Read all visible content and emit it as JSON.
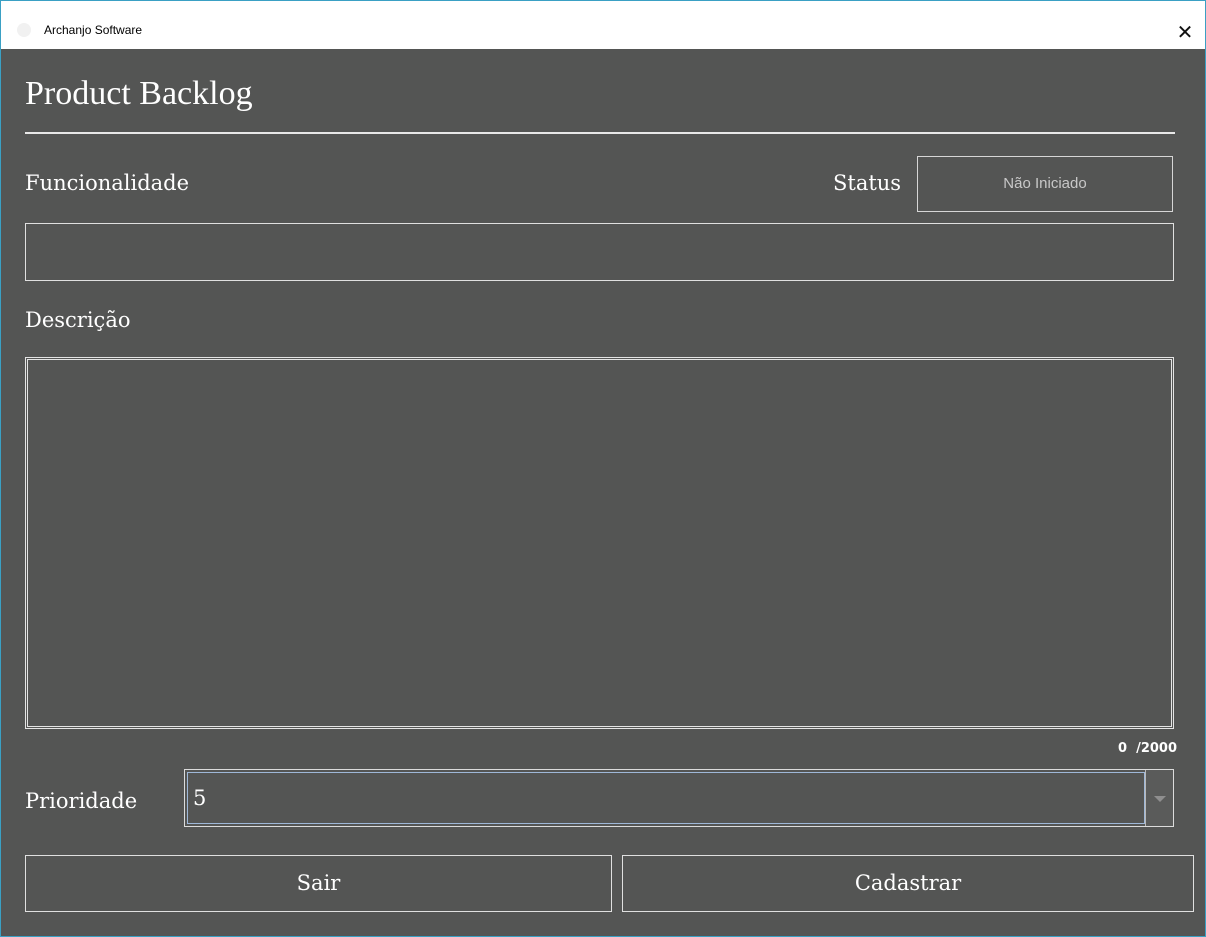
{
  "window": {
    "title": "Archanjo Software",
    "close_glyph": "✕"
  },
  "page": {
    "title": "Product Backlog"
  },
  "form": {
    "funcionalidade_label": "Funcionalidade",
    "funcionalidade_value": "",
    "status_label": "Status",
    "status_value": "Não Iniciado",
    "descricao_label": "Descrição",
    "descricao_value": "",
    "char_counter": "0  /2000",
    "prioridade_label": "Prioridade",
    "prioridade_value": "5"
  },
  "actions": {
    "exit_label": "Sair",
    "submit_label": "Cadastrar"
  },
  "colors": {
    "background": "#545554",
    "text": "#ffffff",
    "border": "#e0e0e0",
    "window_frame": "#3aa0c4"
  }
}
